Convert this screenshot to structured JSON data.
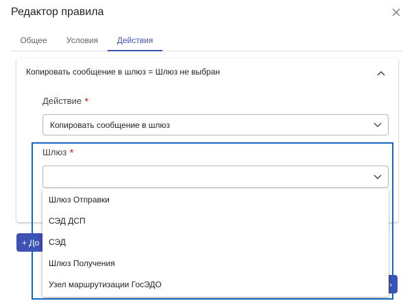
{
  "dialog": {
    "title": "Редактор правила"
  },
  "tabs": [
    {
      "label": "Общее"
    },
    {
      "label": "Условия"
    },
    {
      "label": "Действия"
    }
  ],
  "panel": {
    "header": "Копировать сообщение в шлюз = Шлюз не выбран",
    "action_field": {
      "label": "Действие",
      "required_mark": "*",
      "value": "Копировать сообщение в шлюз"
    },
    "gateway_field": {
      "label": "Шлюз",
      "required_mark": "*",
      "value": ""
    }
  },
  "dropdown": {
    "options": [
      "Шлюз Отправки",
      "СЭД ДСП",
      "СЭД",
      "Шлюз Получения",
      "Узел маршрутизации ГосЭДО"
    ]
  },
  "buttons": {
    "add_label": "+ До"
  },
  "colors": {
    "accent": "#3f51b5",
    "required": "#d32f2f",
    "highlight": "#1565c0"
  }
}
